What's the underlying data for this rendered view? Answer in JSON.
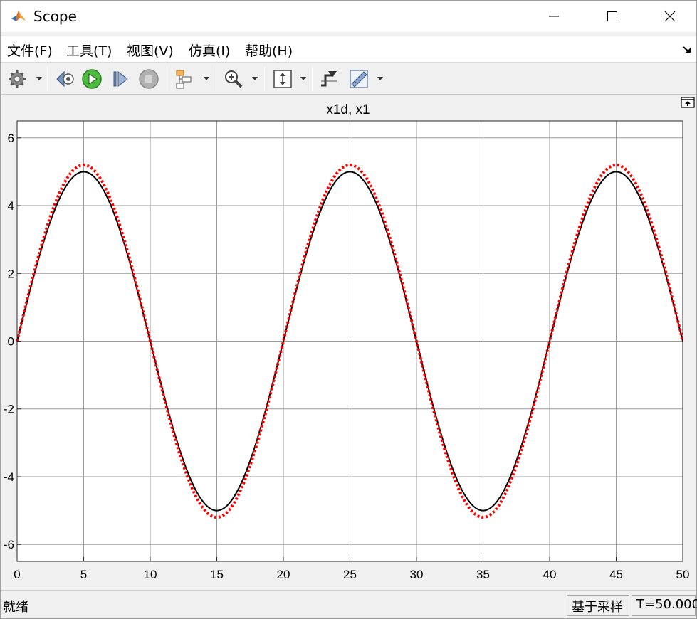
{
  "window": {
    "title": "Scope",
    "icon": "matlab-icon",
    "controls": [
      "minimize-icon",
      "maximize-icon",
      "close-icon"
    ]
  },
  "menubar": {
    "items": [
      {
        "label": "文件(F)",
        "underline": "F"
      },
      {
        "label": "工具(T)",
        "underline": "T"
      },
      {
        "label": "视图(V)",
        "underline": "V"
      },
      {
        "label": "仿真(I)",
        "underline": "I"
      },
      {
        "label": "帮助(H)",
        "underline": "H"
      }
    ]
  },
  "toolbar": {
    "buttons": [
      {
        "name": "settings-button",
        "icon": "gear-icon",
        "dropdown": true
      },
      {
        "name": "step-back-button",
        "icon": "step-back-icon"
      },
      {
        "name": "run-button",
        "icon": "play-icon",
        "color": "#2e9d2e"
      },
      {
        "name": "step-forward-button",
        "icon": "step-forward-icon"
      },
      {
        "name": "stop-button",
        "icon": "stop-icon",
        "disabled": true
      },
      {
        "name": "triggers-button",
        "icon": "signal-selector-icon",
        "dropdown": true
      },
      {
        "name": "zoom-button",
        "icon": "zoom-in-icon",
        "dropdown": true
      },
      {
        "name": "autoscale-button",
        "icon": "autoscale-icon",
        "dropdown": true
      },
      {
        "name": "triggers-marker-button",
        "icon": "trigger-icon"
      },
      {
        "name": "measurements-button",
        "icon": "ruler-icon",
        "dropdown": true
      }
    ]
  },
  "status": {
    "ready": "就绪",
    "mode": "基于采样",
    "time": "T=50.000"
  },
  "chart_data": {
    "type": "line",
    "title": "x1d, x1",
    "xlim": [
      0,
      50
    ],
    "ylim": [
      -6.5,
      6.5
    ],
    "xticks": [
      0,
      5,
      10,
      15,
      20,
      25,
      30,
      35,
      40,
      45,
      50
    ],
    "yticks": [
      6,
      4,
      2,
      0,
      -2,
      -4,
      -6
    ],
    "grid": true,
    "series": [
      {
        "style": "solid",
        "color": "#000000",
        "amplitude": 5.0,
        "period": 20,
        "phase": 0
      },
      {
        "style": "dotted",
        "color": "#ff0000",
        "amplitude": 5.2,
        "period": 20,
        "phase": 0
      }
    ],
    "background": "#ffffff",
    "grid_color": "#9a9a9a"
  }
}
